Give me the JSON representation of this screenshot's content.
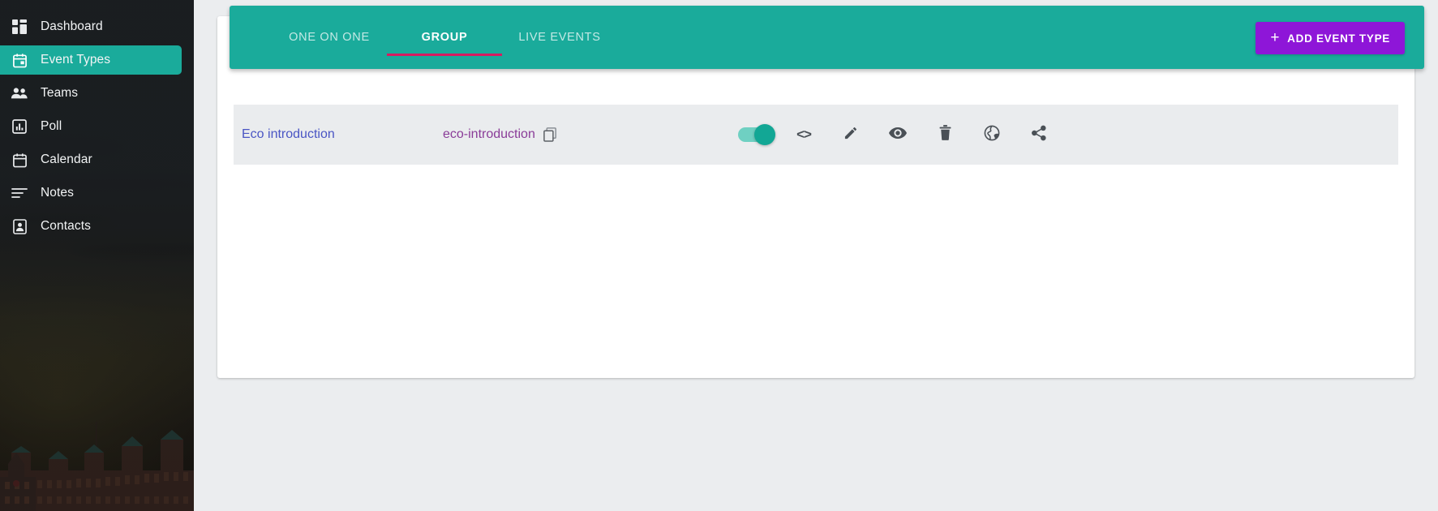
{
  "sidebar": {
    "items": [
      {
        "label": "Dashboard",
        "icon": "dashboard-grid-icon",
        "active": false
      },
      {
        "label": "Event Types",
        "icon": "calendar-event-icon",
        "active": true
      },
      {
        "label": "Teams",
        "icon": "people-icon",
        "active": false
      },
      {
        "label": "Poll",
        "icon": "bar-chart-icon",
        "active": false
      },
      {
        "label": "Calendar",
        "icon": "calendar-icon",
        "active": false
      },
      {
        "label": "Notes",
        "icon": "notes-lines-icon",
        "active": false
      },
      {
        "label": "Contacts",
        "icon": "contact-card-icon",
        "active": false
      }
    ],
    "active_color": "#1aab9b",
    "background": "#1f2326"
  },
  "header": {
    "background_color": "#1aab9b",
    "tabs": [
      {
        "label": "ONE ON ONE",
        "active": false
      },
      {
        "label": "GROUP",
        "active": true
      },
      {
        "label": "LIVE EVENTS",
        "active": false
      }
    ],
    "active_tab_underline_color": "#d81b60",
    "add_button": {
      "label": "ADD EVENT TYPE",
      "plus": "+",
      "color": "#8e16d8"
    }
  },
  "content": {
    "rows": [
      {
        "title": "Eco introduction",
        "title_color": "#4a55c4",
        "slug": "eco-introduction",
        "slug_color": "#8a3c98",
        "copy_icon": "copy-icon",
        "enabled": true,
        "actions": [
          {
            "name": "embed-code-action",
            "icon": "code-brackets-icon",
            "glyph": "<>"
          },
          {
            "name": "edit-action",
            "icon": "pencil-icon"
          },
          {
            "name": "preview-action",
            "icon": "eye-icon"
          },
          {
            "name": "delete-action",
            "icon": "trash-icon"
          },
          {
            "name": "public-page-action",
            "icon": "globe-icon"
          },
          {
            "name": "share-action",
            "icon": "share-icon"
          }
        ]
      }
    ]
  },
  "page": {
    "background_color": "#ebedef",
    "card_background": "#ffffff"
  }
}
